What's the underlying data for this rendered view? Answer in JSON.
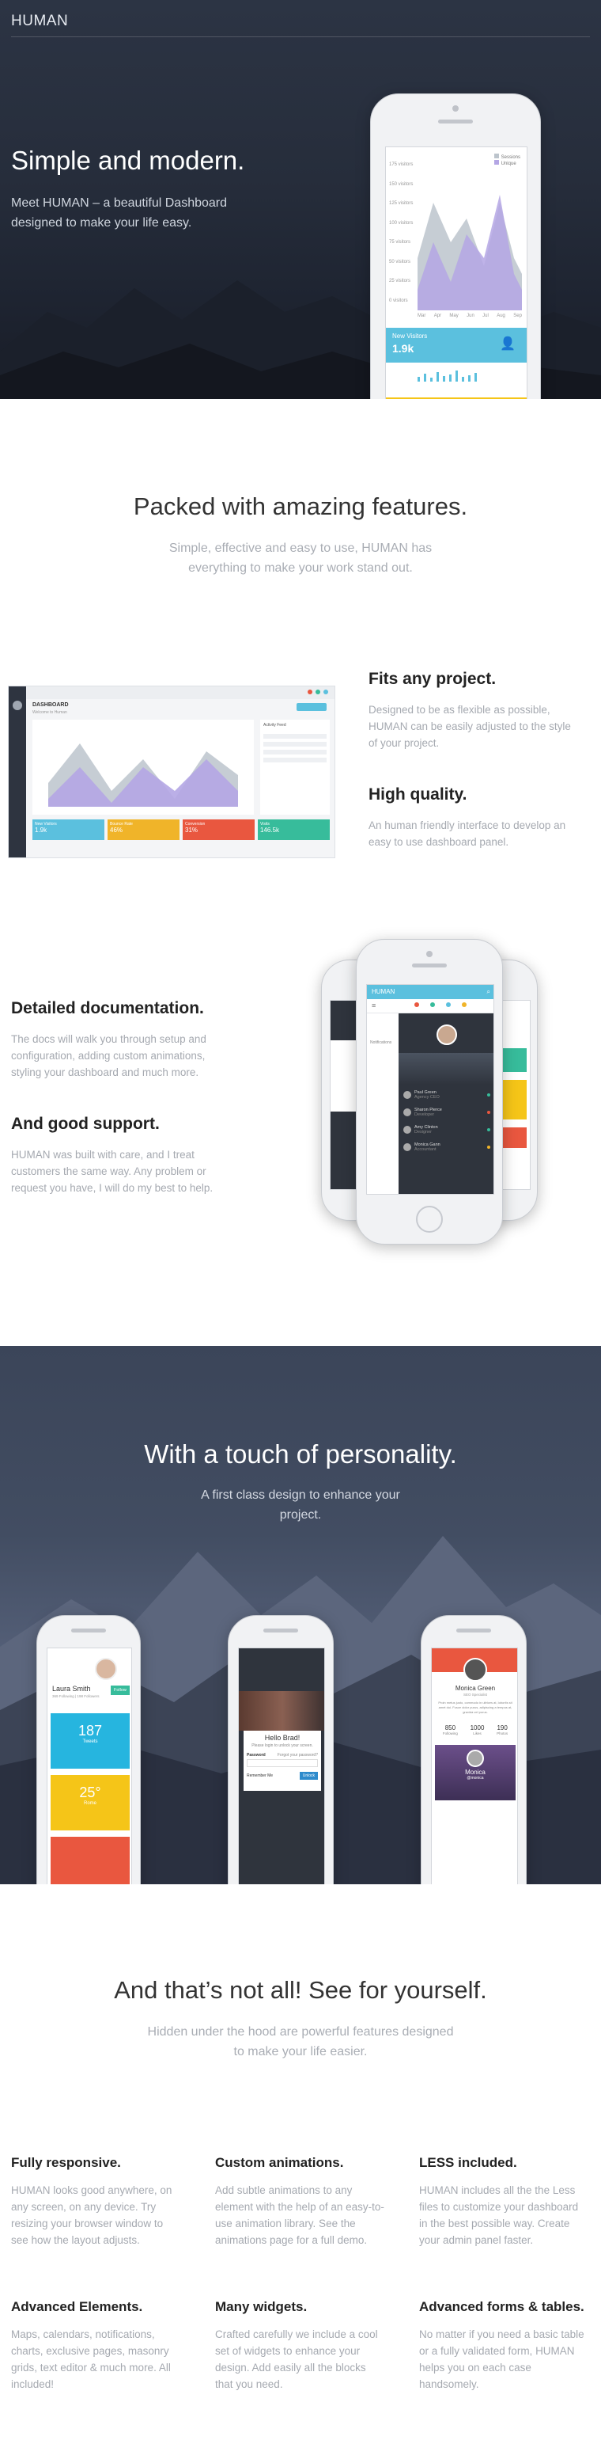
{
  "hero": {
    "logo": "HUMAN",
    "title": "Simple and modern.",
    "subtitle": "Meet HUMAN – a beautiful Dashboard designed to make your life easy.",
    "phone": {
      "legend": [
        "Sessions",
        "Unique"
      ],
      "y_ticks": [
        "175 visitors",
        "150 visitors",
        "125 visitors",
        "100 visitors",
        "75 visitors",
        "50 visitors",
        "25 visitors",
        "0 visitors"
      ],
      "x_ticks": [
        "Mar",
        "Apr",
        "May",
        "Jun",
        "Jul",
        "Aug",
        "Sep"
      ],
      "card_label": "New Visitors",
      "card_value": "1.9k"
    }
  },
  "features_head": {
    "title": "Packed with amazing features.",
    "subtitle": "Simple, effective and easy to use, HUMAN has everything to make your work stand out."
  },
  "dashboard": {
    "title": "DASHBOARD",
    "subtitle": "Welcome to Human",
    "activity": "Activity Feed",
    "stats": [
      {
        "label": "New Visitors",
        "value": "1.9k",
        "color": "#5bc0de"
      },
      {
        "label": "Bounce Rate",
        "value": "46%",
        "color": "#f0b429"
      },
      {
        "label": "Conversion",
        "value": "31%",
        "color": "#e9573f"
      },
      {
        "label": "Visits",
        "value": "146.5k",
        "color": "#37bc9b"
      }
    ]
  },
  "features": [
    {
      "title": "Fits any project.",
      "text": "Designed to be as flexible as possible, HUMAN can be easily adjusted to the style of your project."
    },
    {
      "title": "High quality.",
      "text": "An human friendly interface to develop an easy to use dashboard panel."
    },
    {
      "title": "Detailed documentation.",
      "text": "The docs will walk you through setup and configuration, adding custom animations, styling your dashboard and much more."
    },
    {
      "title": "And good support.",
      "text": "HUMAN was built with care, and I treat customers the same way. Any problem or request you have, I will do my best to help."
    }
  ],
  "support_phone": {
    "brand": "HUMAN",
    "contacts": [
      {
        "name": "Paul Green",
        "role": "Agency CEO"
      },
      {
        "name": "Sharon Pierce",
        "role": "Developer"
      },
      {
        "name": "Amy Clinton",
        "role": "Designer"
      },
      {
        "name": "Monica Gann",
        "role": "Accountant"
      }
    ],
    "side_label": "Notifications"
  },
  "personality": {
    "title": "With a touch of personality.",
    "subtitle": "A first class design to enhance your project.",
    "phone1": {
      "name": "Laura Smith",
      "meta": "369 Following  |  198 Followers",
      "follow": "Follow",
      "tile1_value": "187",
      "tile1_label": "Tweets",
      "tile2_value": "25°",
      "tile2_label": "Rome"
    },
    "phone2": {
      "greeting": "Hello Brad!",
      "prompt": "Please login to unlock your screen.",
      "password_label": "Password",
      "forgot": "Forgot your password?",
      "remember": "Remember Me",
      "unlock": "Unlock"
    },
    "phone3": {
      "name": "Monica Green",
      "role": "SEO Specialist",
      "bio": "Proin metus justo, commodo in ultrices at, lobortis sit amet dui. Fusce dolor purus, adipiscing a tempus at, gravida vel purus.",
      "stats": [
        {
          "v": "850",
          "l": "Following"
        },
        {
          "v": "1000",
          "l": "Likes"
        },
        {
          "v": "190",
          "l": "Photos"
        }
      ],
      "card_name": "Monica",
      "card_handle": "@monica"
    }
  },
  "more": {
    "title": "And that’s not all! See for yourself.",
    "subtitle": "Hidden under the hood are powerful features designed to make your life easier.",
    "items": [
      {
        "title": "Fully responsive.",
        "text": "HUMAN looks good anywhere, on any screen, on any device. Try resizing your browser window to see how the layout adjusts."
      },
      {
        "title": "Custom animations.",
        "text": "Add subtle animations to any element with the help of an easy-to-use animation library. See the animations page for a full demo."
      },
      {
        "title": "LESS included.",
        "text": "HUMAN includes all the the Less files to customize your dashboard in the best possible way. Create your admin panel faster."
      },
      {
        "title": "Advanced Elements.",
        "text": "Maps, calendars, notifications, charts, exclusive pages, masonry grids, text editor & much more. All included!"
      },
      {
        "title": "Many widgets.",
        "text": "Crafted carefully we include a cool set of widgets to enhance your design. Add easily all the blocks that you need."
      },
      {
        "title": "Advanced forms & tables.",
        "text": "No matter if you need a basic table or a fully validated form, HUMAN helps you on each case handsomely."
      }
    ]
  }
}
